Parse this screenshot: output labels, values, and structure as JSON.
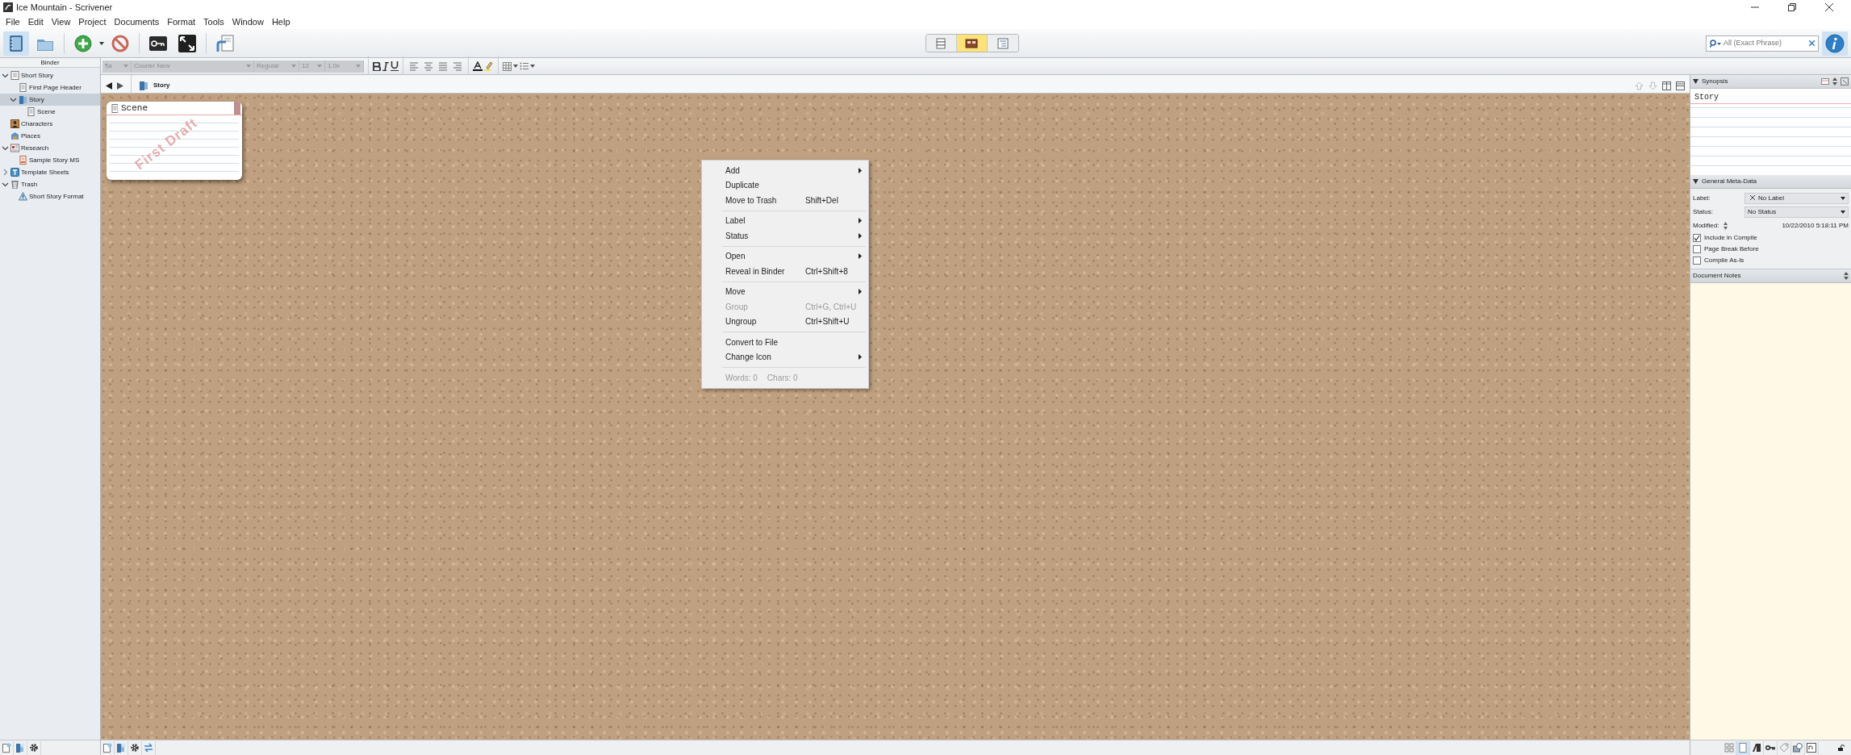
{
  "window": {
    "title": "Ice Mountain - Scrivener"
  },
  "menu_bar": [
    "File",
    "Edit",
    "View",
    "Project",
    "Documents",
    "Format",
    "Tools",
    "Window",
    "Help"
  ],
  "view_modes": [
    {
      "kind": "scrivenings",
      "selected": false
    },
    {
      "kind": "corkboard",
      "selected": true
    },
    {
      "kind": "outline",
      "selected": false
    }
  ],
  "search": {
    "placeholder": "All (Exact Phrase)"
  },
  "binder": {
    "header": "Binder",
    "items": [
      {
        "label": "Short Story",
        "kind": "folder-text",
        "expanded": true,
        "selected": false,
        "children": [
          {
            "label": "First Page Header",
            "kind": "text",
            "selected": false
          },
          {
            "label": "Story",
            "kind": "folder",
            "expanded": true,
            "selected": true,
            "children": [
              {
                "label": "Scene",
                "kind": "text",
                "selected": false
              }
            ]
          }
        ]
      },
      {
        "label": "Characters",
        "kind": "characters",
        "selected": false
      },
      {
        "label": "Places",
        "kind": "places",
        "selected": false
      },
      {
        "label": "Research",
        "kind": "research",
        "expanded": true,
        "selected": false,
        "children": [
          {
            "label": "Sample Story MS",
            "kind": "pdf",
            "selected": false
          }
        ]
      },
      {
        "label": "Template Sheets",
        "kind": "template",
        "expanded": false,
        "selected": false
      },
      {
        "label": "Trash",
        "kind": "trash",
        "expanded": true,
        "selected": false,
        "children": [
          {
            "label": "Short Story Format",
            "kind": "warning",
            "selected": false
          }
        ]
      }
    ]
  },
  "format_bar": {
    "disabled": true,
    "paragraph_style": "¶a",
    "font": "Courier New",
    "font_style": "Regular",
    "size": "12",
    "line_spacing": "1.0x"
  },
  "editor": {
    "header_title": "Story"
  },
  "corkboard": {
    "cards": [
      {
        "title": "Scene",
        "stamp": "First Draft"
      }
    ]
  },
  "context_menu": {
    "items": [
      {
        "kind": "item",
        "label": "Add",
        "submenu": true,
        "disabled": false
      },
      {
        "kind": "item",
        "label": "Duplicate",
        "submenu": false,
        "disabled": false
      },
      {
        "kind": "item",
        "label": "Move to Trash",
        "shortcut": "Shift+Del",
        "submenu": false,
        "disabled": false
      },
      {
        "kind": "separator"
      },
      {
        "kind": "item",
        "label": "Label",
        "submenu": true,
        "disabled": false
      },
      {
        "kind": "item",
        "label": "Status",
        "submenu": true,
        "disabled": false
      },
      {
        "kind": "separator"
      },
      {
        "kind": "item",
        "label": "Open",
        "submenu": true,
        "disabled": false
      },
      {
        "kind": "item",
        "label": "Reveal in Binder",
        "shortcut": "Ctrl+Shift+8",
        "submenu": false,
        "disabled": false
      },
      {
        "kind": "separator"
      },
      {
        "kind": "item",
        "label": "Move",
        "submenu": true,
        "disabled": false
      },
      {
        "kind": "item",
        "label": "Group",
        "shortcut": "Ctrl+G, Ctrl+U",
        "submenu": false,
        "disabled": true
      },
      {
        "kind": "item",
        "label": "Ungroup",
        "shortcut": "Ctrl+Shift+U",
        "submenu": false,
        "disabled": false
      },
      {
        "kind": "separator"
      },
      {
        "kind": "item",
        "label": "Convert to File",
        "submenu": false,
        "disabled": false
      },
      {
        "kind": "item",
        "label": "Change Icon",
        "submenu": true,
        "disabled": false
      },
      {
        "kind": "separator"
      },
      {
        "kind": "info",
        "words": "Words: 0",
        "chars": "Chars: 0"
      }
    ]
  },
  "inspector": {
    "synopsis": {
      "header": "Synopsis",
      "text": "Story"
    },
    "meta": {
      "header": "General Meta-Data",
      "label_caption": "Label:",
      "label_value": "No Label",
      "status_caption": "Status:",
      "status_value": "No Status",
      "modified_caption": "Modified:",
      "modified_value": "10/22/2010 5:18:11 PM",
      "checkboxes": [
        {
          "label": "Include in Compile",
          "checked": true
        },
        {
          "label": "Page Break Before",
          "checked": false
        },
        {
          "label": "Compile As-Is",
          "checked": false
        }
      ]
    },
    "notes": {
      "header": "Document Notes"
    }
  }
}
